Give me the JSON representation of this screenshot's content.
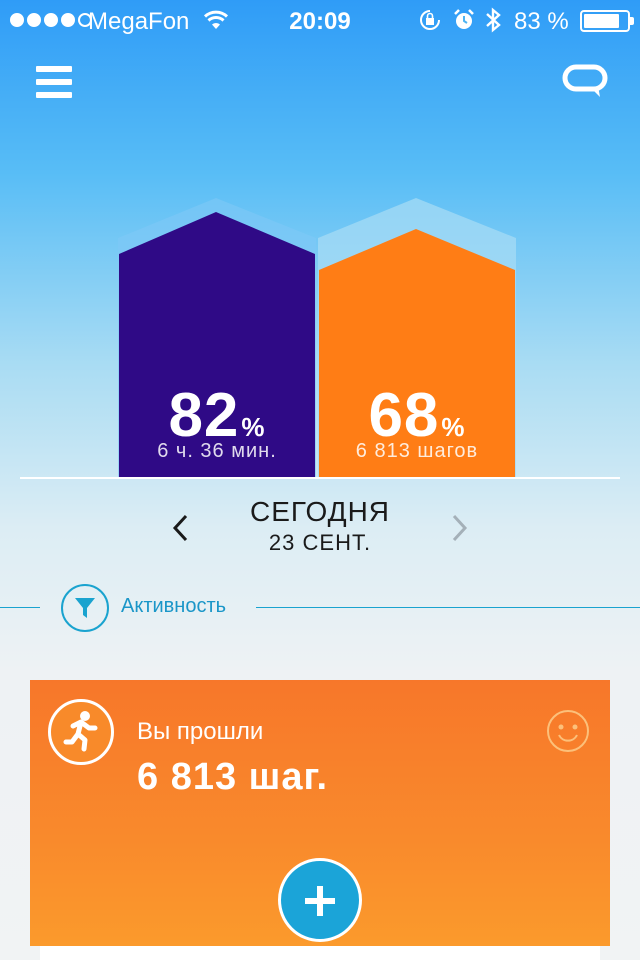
{
  "status_bar": {
    "carrier": "MegaFon",
    "time": "20:09",
    "battery_percent": "83 %",
    "battery_level": 0.83,
    "signal_bars": 4,
    "signal_max": 5
  },
  "nav": {
    "menu_icon": "hamburger-menu-icon",
    "chat_icon": "chat-bubble-icon"
  },
  "sleep": {
    "percent": "82",
    "unit": "%",
    "detail": "6 ч. 36 мин.",
    "level": 0.82,
    "color": "#2f0a86"
  },
  "steps": {
    "percent": "68",
    "unit": "%",
    "detail": "6 813 шагов",
    "level": 0.68,
    "color": "#ff7d15"
  },
  "date": {
    "title": "СЕГОДНЯ",
    "subtitle": "23 СЕНТ.",
    "prev_icon": "chevron-left-icon",
    "next_icon": "chevron-right-icon"
  },
  "filter": {
    "label": "Активность",
    "icon": "funnel-filter-icon"
  },
  "activity_card": {
    "label": "Вы прошли",
    "value": "6 813 шаг.",
    "icon": "running-person-icon",
    "mood_icon": "smiley-icon",
    "add_icon": "plus-icon",
    "colors": {
      "card": "#f98a2c",
      "add_button": "#1ba4d8",
      "accent": "#1aa3cf"
    }
  }
}
